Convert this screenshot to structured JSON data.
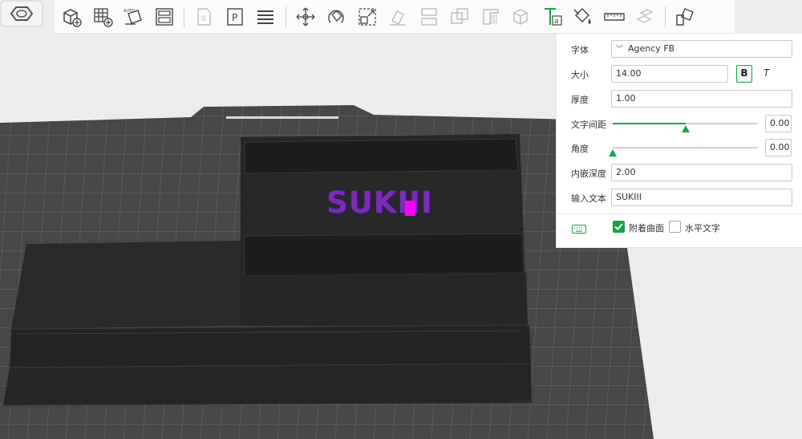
{
  "toolbar": {
    "icons": [
      "add-part-icon",
      "grid-add-icon",
      "auto-arrange-icon",
      "layout-icon",
      "page-icon",
      "plate-p-icon",
      "layers-icon",
      "move-icon",
      "rotate-icon",
      "scale-icon",
      "flatten-icon",
      "split-icon",
      "boolean-icon",
      "support-paint-icon",
      "seam-icon",
      "text-tool-icon",
      "color-paint-icon",
      "measure-icon",
      "assembly-icon",
      "assemble-icon"
    ]
  },
  "text_panel": {
    "font": {
      "label": "字体",
      "value": "Agency FB"
    },
    "size": {
      "label": "大小",
      "value": "14.00",
      "bold": "B",
      "italic": "T"
    },
    "thickness": {
      "label": "厚度",
      "value": "1.00"
    },
    "spacing": {
      "label": "文字间距",
      "value": "0.00",
      "level": 0.5
    },
    "angle": {
      "label": "角度",
      "value": "0.00",
      "level": 0.0
    },
    "emboss_depth": {
      "label": "内嵌深度",
      "value": "2.00"
    },
    "input_text": {
      "label": "输入文本",
      "value": "SUKIII"
    },
    "surface_attach": {
      "label": "附着曲面",
      "checked": true
    },
    "horizontal_text": {
      "label": "水平文字",
      "checked": false
    }
  },
  "model": {
    "text": "SUKIII",
    "text_color": "#7a2bb8",
    "cursor_color": "#ff00ff"
  },
  "colors": {
    "accent": "#17a64b",
    "bed": "#4a4a4a",
    "model": "#262626"
  }
}
